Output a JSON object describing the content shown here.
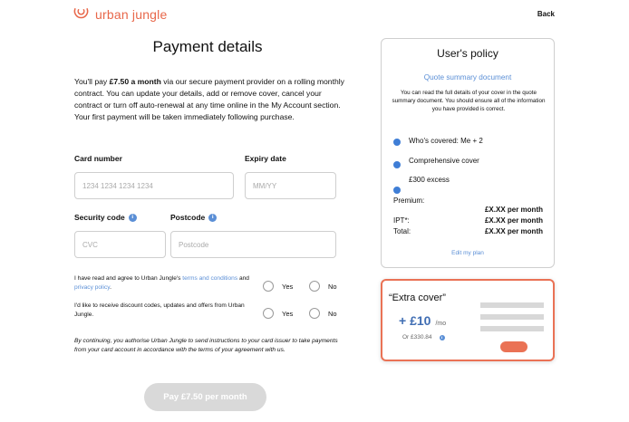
{
  "header": {
    "brand": "urban jungle",
    "back_label": "Back"
  },
  "payment": {
    "title": "Payment details",
    "intro_prefix": "You'll pay ",
    "intro_amount": "£7.50 a month",
    "intro_suffix": " via our secure payment provider on a rolling monthly contract. You can update your details, add or remove cover, cancel your contract or turn off auto-renewal at any time online in the My Account section. Your first payment will be taken immediately following purchase.",
    "card_number_label": "Card number",
    "card_number_placeholder": "1234 1234 1234 1234",
    "expiry_label": "Expiry date",
    "expiry_placeholder": "MM/YY",
    "security_label": "Security code",
    "security_placeholder": "CVC",
    "postcode_label": "Postcode",
    "postcode_placeholder": "Postcode",
    "terms_prefix": "I have read and agree to Urban Jungle's ",
    "terms_link": "terms and conditions",
    "terms_mid": " and ",
    "privacy_link": "privacy policy",
    "terms_suffix": ".",
    "marketing_text": "I'd like to receive discount codes, updates and offers from Urban Jungle.",
    "yes_label": "Yes",
    "no_label": "No",
    "disclaimer": "By continuing, you authorise Urban Jungle to send instructions to your card issuer to take payments from your card account in accordance with the terms of your agreement with us.",
    "pay_button": "Pay £7.50 per month"
  },
  "policy": {
    "title": "User's policy",
    "summary_link": "Quote summary document",
    "description": "You can read the full details of your cover in the quote summary document. You should ensure all of the information you have provided is correct.",
    "items": [
      "Who's covered: Me + 2",
      "Comprehensive cover",
      "£300 excess"
    ],
    "premium_label": "Premium:",
    "premium_value": "£X.XX per month",
    "ipt_label": "IPT*:",
    "ipt_value": "£X.XX per month",
    "total_label": "Total:",
    "total_value": "£X.XX per month",
    "edit_link": "Edit my plan"
  },
  "extra_cover": {
    "title": "“Extra cover”",
    "price": "+ £10",
    "per": "/mo",
    "was": "Or £330.84",
    "toggle_on": true,
    "accent": "#ea7255"
  },
  "colors": {
    "brand": "#e8674a",
    "link": "#5b8fd6",
    "bullet": "#3f7ed6"
  }
}
